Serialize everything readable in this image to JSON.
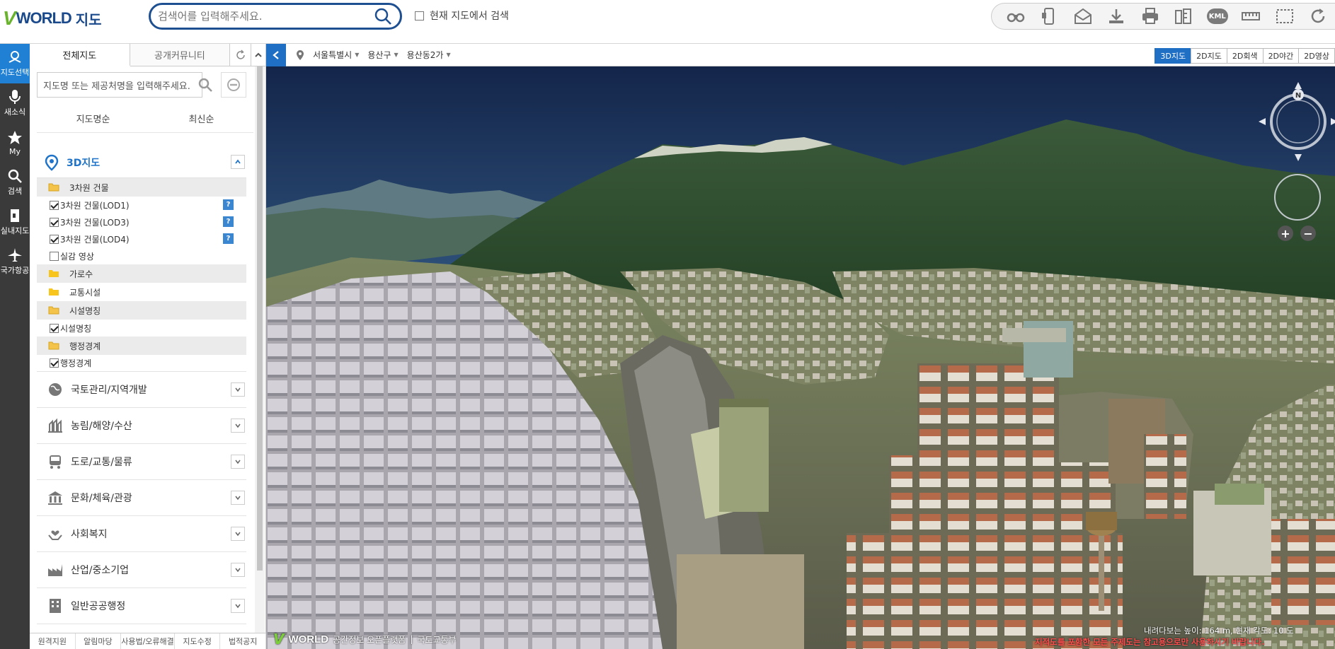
{
  "header": {
    "logo_v": "V",
    "logo_world": "WORLD",
    "logo_ko": "지도",
    "search_placeholder": "검색어를 입력해주세요.",
    "local_search_label": "현재 지도에서 검색",
    "tools": [
      "binoculars-icon",
      "phone-share-icon",
      "mail-icon",
      "download-icon",
      "print-icon",
      "measure-icon",
      "kml-icon",
      "ruler-icon",
      "area-select-icon",
      "refresh-icon"
    ],
    "kml_label": "KML"
  },
  "rail": {
    "items": [
      {
        "label": "지도선택",
        "icon": "map-pin-icon",
        "active": true
      },
      {
        "label": "새소식",
        "icon": "microphone-icon"
      },
      {
        "label": "My",
        "icon": "star-icon"
      },
      {
        "label": "검색",
        "icon": "search-icon"
      },
      {
        "label": "실내지도",
        "icon": "indoor-map-icon"
      },
      {
        "label": "국가항공",
        "icon": "airplane-icon"
      }
    ]
  },
  "panel": {
    "tabs": [
      {
        "label": "전체지도",
        "active": true
      },
      {
        "label": "공개커뮤니티",
        "active": false
      }
    ],
    "map_search_placeholder": "지도명 또는 제공처명을 입력해주세요.",
    "sort": [
      "지도명순",
      "최신순"
    ],
    "section_3d": {
      "label": "3D지도",
      "groups": [
        {
          "label": "3차원 건물",
          "open": true,
          "items": [
            {
              "label": "3차원 건물(LOD1)",
              "checked": true,
              "help": "?"
            },
            {
              "label": "3차원 건물(LOD3)",
              "checked": true,
              "help": "?"
            },
            {
              "label": "3차원 건물(LOD4)",
              "checked": true,
              "help": "?"
            },
            {
              "label": "실감 영상",
              "checked": false
            }
          ]
        },
        {
          "label": "가로수",
          "open": false,
          "items": []
        },
        {
          "label": "교통시설",
          "open": false,
          "items": []
        },
        {
          "label": "시설명칭",
          "open": true,
          "items": [
            {
              "label": "시설명칭",
              "checked": true
            }
          ]
        },
        {
          "label": "행정경계",
          "open": true,
          "items": [
            {
              "label": "행정경계",
              "checked": true
            }
          ]
        }
      ]
    },
    "categories": [
      {
        "label": "국토관리/지역개발",
        "icon": "globe-icon"
      },
      {
        "label": "농림/해양/수산",
        "icon": "farm-icon"
      },
      {
        "label": "도로/교통/물류",
        "icon": "vehicle-icon"
      },
      {
        "label": "문화/체육/관광",
        "icon": "landmark-icon"
      },
      {
        "label": "사회복지",
        "icon": "hands-heart-icon"
      },
      {
        "label": "산업/중소기업",
        "icon": "factory-icon"
      },
      {
        "label": "일반공공행정",
        "icon": "building-icon"
      }
    ],
    "footer": [
      "원격지원",
      "알림마당",
      "사용법/오류해결",
      "지도수정",
      "법적공지"
    ]
  },
  "map": {
    "location": [
      "서울특별시",
      "용산구",
      "용산동2가"
    ],
    "map_types": [
      {
        "label": "3D지도",
        "active": true
      },
      {
        "label": "2D지도",
        "active": false
      },
      {
        "label": "2D회색",
        "active": false
      },
      {
        "label": "2D야간",
        "active": false
      },
      {
        "label": "2D영상",
        "active": false
      }
    ],
    "compass_north": "N",
    "zoom_in": "+",
    "zoom_out": "−",
    "brand_v": "V",
    "brand_world": "WORLD",
    "brand_tagline": "공간정보 오픈플랫폼",
    "brand_sep": "|",
    "brand_org": "국토교통부",
    "view_info": "내려다보는 높이: 164 m, 현재 각도: 10 도",
    "disclaimer": "지적도를 포함한 모든 주제도는 참고용으로만 사용하시기 바랍니다."
  }
}
